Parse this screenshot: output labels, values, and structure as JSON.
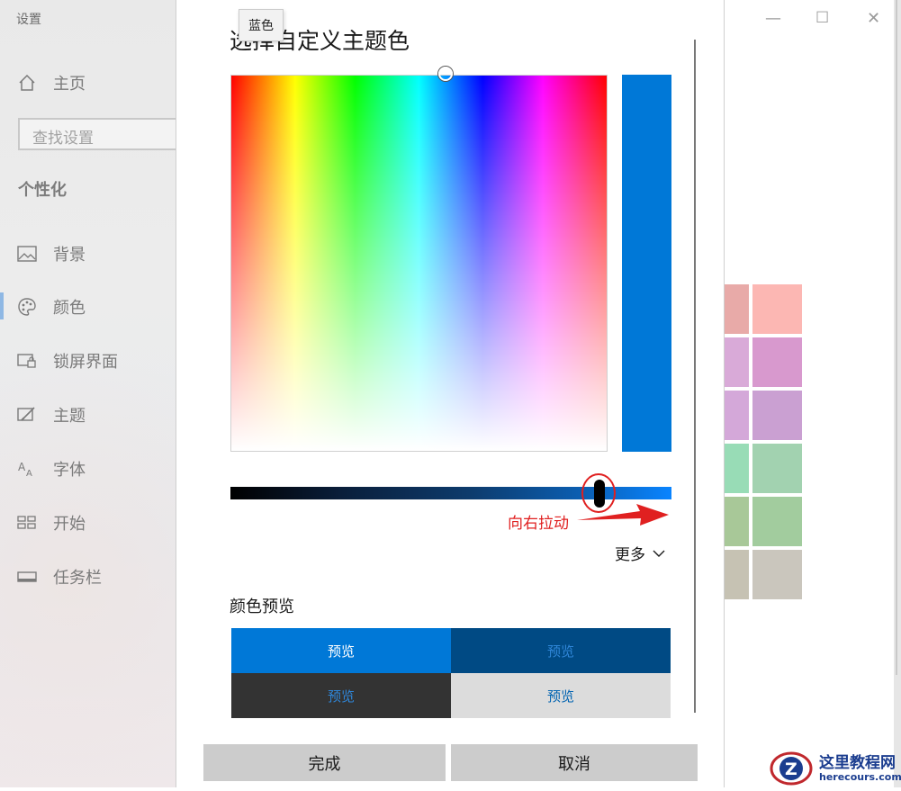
{
  "settings": {
    "app_title": "设置",
    "home": "主页",
    "search_placeholder": "查找设置",
    "section": "个性化",
    "nav": [
      {
        "label": "背景",
        "icon": "image-icon"
      },
      {
        "label": "颜色",
        "icon": "palette-icon"
      },
      {
        "label": "锁屏界面",
        "icon": "lock-screen-icon"
      },
      {
        "label": "主题",
        "icon": "theme-icon"
      },
      {
        "label": "字体",
        "icon": "font-icon"
      },
      {
        "label": "开始",
        "icon": "start-icon"
      },
      {
        "label": "任务栏",
        "icon": "taskbar-icon"
      }
    ],
    "active_item": "颜色",
    "window_controls": {
      "minimize": "—",
      "maximize": "☐",
      "close": "✕"
    },
    "swatch_colors": [
      "#e8aaa8",
      "#fcb7b3",
      "#d9aad8",
      "#d899ce",
      "#d4a8d9",
      "#caa0d2",
      "#98dcb6",
      "#a2d2b0",
      "#a8c898",
      "#a2cc9e",
      "#c6c2b3",
      "#cac6bd"
    ]
  },
  "dialog": {
    "title": "选择自定义主题色",
    "tooltip": "蓝色",
    "selected_color": "#0078d7",
    "hue_handle_position": 0.57,
    "value_slider_position": 0.83,
    "annotation": "向右拉动",
    "more_label": "更多",
    "preview_heading": "颜色预览",
    "previews": [
      {
        "label": "预览",
        "bg": "#0078d7",
        "fg": "#ffffff"
      },
      {
        "label": "预览",
        "bg": "#004a84",
        "fg": "#2f86d8"
      },
      {
        "label": "预览",
        "bg": "#333333",
        "fg": "#2f86d8"
      },
      {
        "label": "预览",
        "bg": "#dcdcdc",
        "fg": "#0063b1"
      }
    ],
    "done_label": "完成",
    "cancel_label": "取消"
  },
  "watermark": {
    "title": "这里教程网",
    "url": "herecours.com"
  }
}
